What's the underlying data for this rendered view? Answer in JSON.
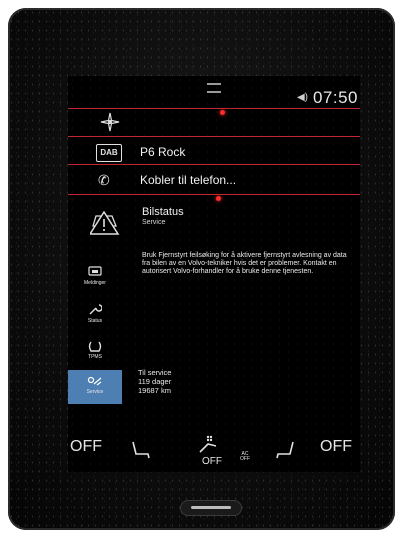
{
  "statusbar": {
    "time": "07:50",
    "volume_icon": "speaker-icon"
  },
  "tiles": {
    "navigation_icon": "compass-icon",
    "radio": {
      "badge": "DAB",
      "label": "P6 Rock"
    },
    "phone": {
      "label": "Kobler til telefon..."
    }
  },
  "app": {
    "title": "Bilstatus",
    "subtitle": "Service",
    "message": "Bruk Fjernstyrt feilsøking for å aktivere fjernstyrt avlesning av data fra bilen av en Volvo-tekniker hvis det er problemer. Kontakt en autorisert Volvo-forhandler for å bruke denne tjenesten.",
    "sidebar": [
      {
        "label": "Meldinger",
        "icon": "car-message-icon"
      },
      {
        "label": "Status",
        "icon": "wrench-icon"
      },
      {
        "label": "TPMS",
        "icon": "tire-pressure-icon"
      },
      {
        "label": "Service",
        "icon": "service-icon",
        "active": true
      }
    ],
    "service": {
      "line1": "Til service",
      "line2": "119 dager",
      "line3": "19687 km"
    }
  },
  "climate": {
    "left_temp": "OFF",
    "right_temp": "OFF",
    "fan": "OFF",
    "ac_line1": "AC",
    "ac_line2": "OFF"
  },
  "colors": {
    "accent_red": "#c0262e",
    "active_tab": "#4d7fb2"
  }
}
